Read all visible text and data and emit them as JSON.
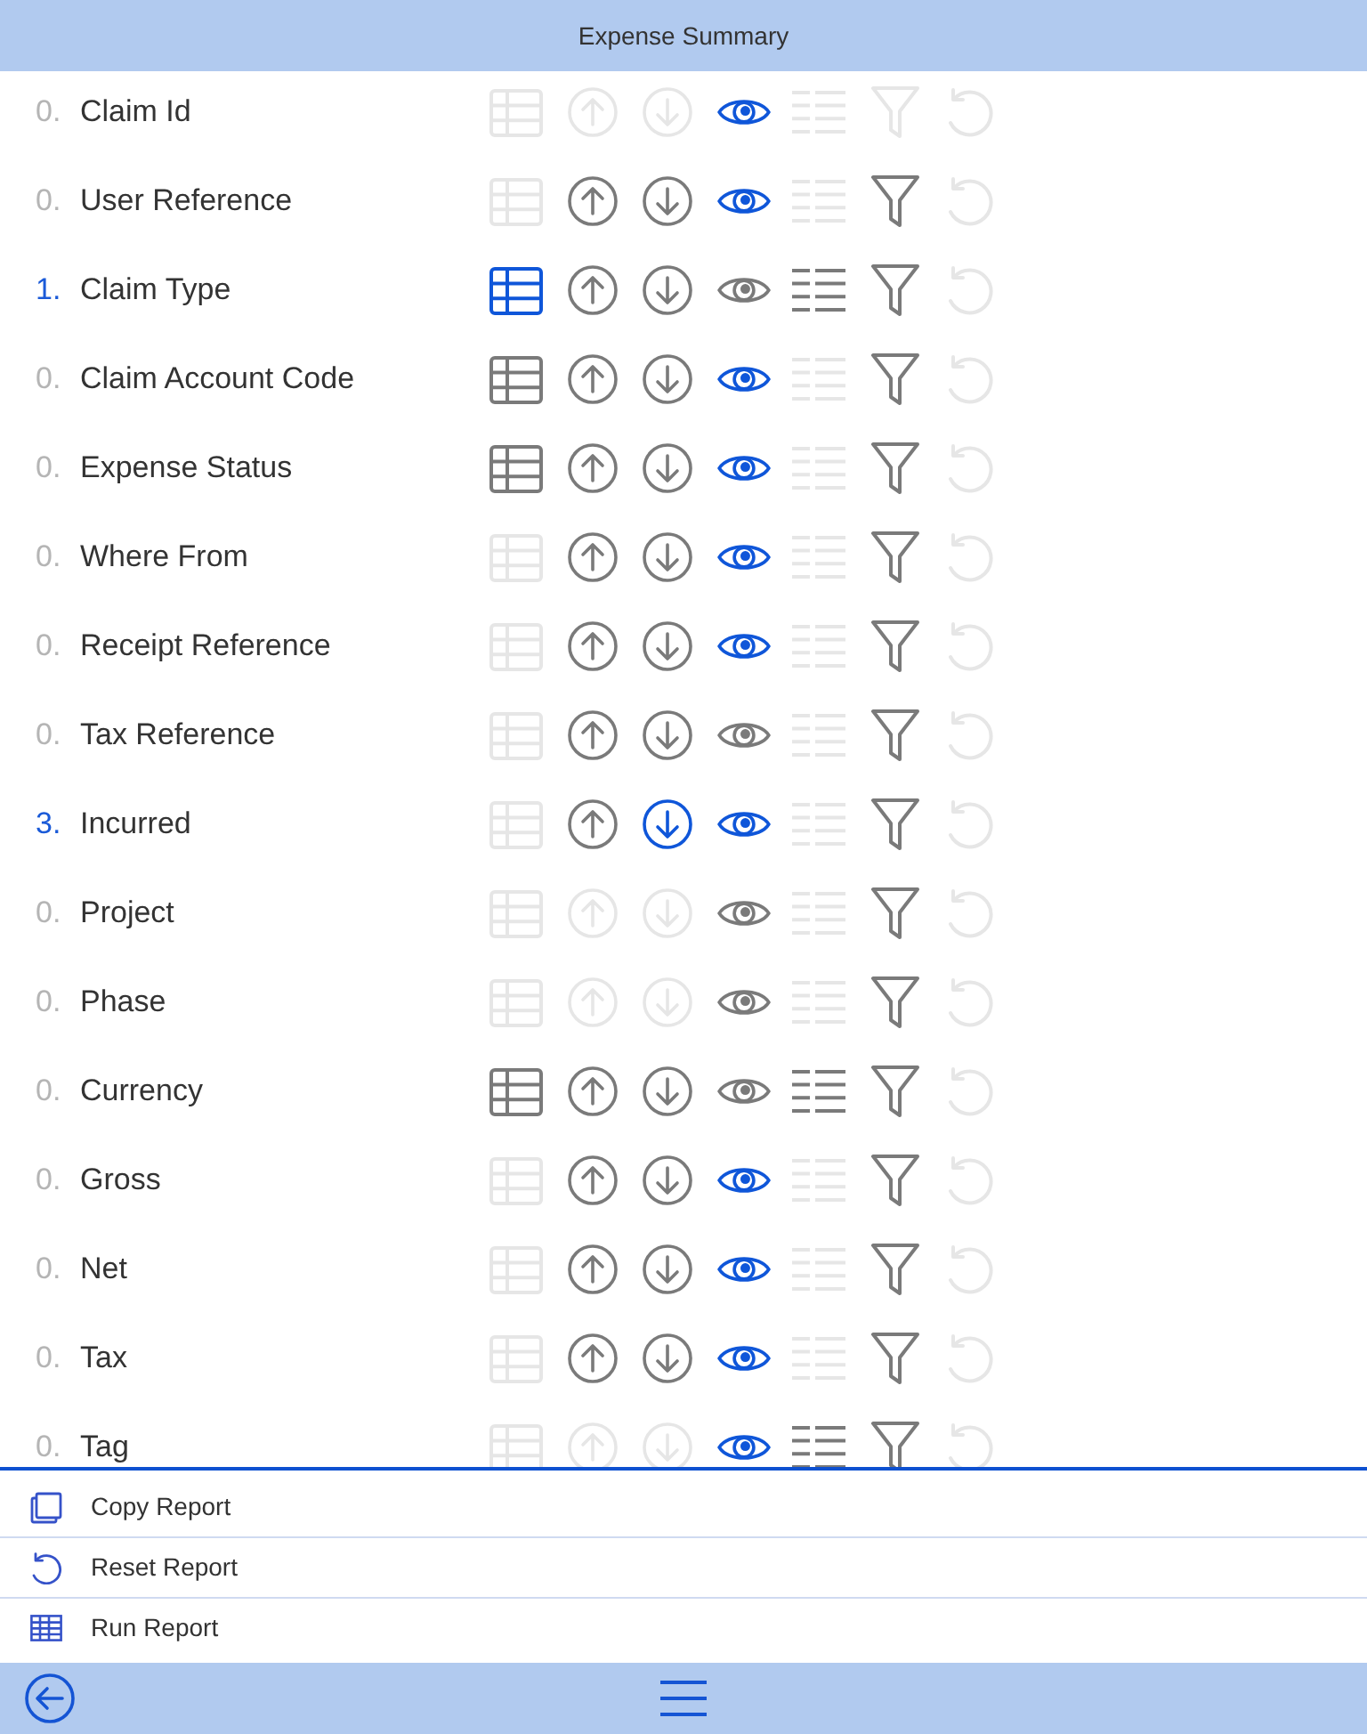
{
  "header": {
    "title": "Expense Summary"
  },
  "fields": [
    {
      "order": "0.",
      "order_active": false,
      "label": "Claim Id",
      "controls": {
        "table": {
          "disabled": true,
          "active": false
        },
        "sort_up": {
          "disabled": true,
          "active": false
        },
        "sort_down": {
          "disabled": true,
          "active": false
        },
        "eye": {
          "disabled": false,
          "active": true
        },
        "list": {
          "disabled": true,
          "active": false
        },
        "filter": {
          "disabled": true,
          "active": false
        },
        "reset": {
          "disabled": true,
          "active": false
        }
      }
    },
    {
      "order": "0.",
      "order_active": false,
      "label": "User Reference",
      "controls": {
        "table": {
          "disabled": true,
          "active": false
        },
        "sort_up": {
          "disabled": false,
          "active": false
        },
        "sort_down": {
          "disabled": false,
          "active": false
        },
        "eye": {
          "disabled": false,
          "active": true
        },
        "list": {
          "disabled": true,
          "active": false
        },
        "filter": {
          "disabled": false,
          "active": false
        },
        "reset": {
          "disabled": true,
          "active": false
        }
      }
    },
    {
      "order": "1.",
      "order_active": true,
      "label": "Claim Type",
      "controls": {
        "table": {
          "disabled": false,
          "active": true
        },
        "sort_up": {
          "disabled": false,
          "active": false
        },
        "sort_down": {
          "disabled": false,
          "active": false
        },
        "eye": {
          "disabled": false,
          "active": false
        },
        "list": {
          "disabled": false,
          "active": false
        },
        "filter": {
          "disabled": false,
          "active": false
        },
        "reset": {
          "disabled": true,
          "active": false
        }
      }
    },
    {
      "order": "0.",
      "order_active": false,
      "label": "Claim Account Code",
      "controls": {
        "table": {
          "disabled": false,
          "active": false
        },
        "sort_up": {
          "disabled": false,
          "active": false
        },
        "sort_down": {
          "disabled": false,
          "active": false
        },
        "eye": {
          "disabled": false,
          "active": true
        },
        "list": {
          "disabled": true,
          "active": false
        },
        "filter": {
          "disabled": false,
          "active": false
        },
        "reset": {
          "disabled": true,
          "active": false
        }
      }
    },
    {
      "order": "0.",
      "order_active": false,
      "label": "Expense Status",
      "controls": {
        "table": {
          "disabled": false,
          "active": false
        },
        "sort_up": {
          "disabled": false,
          "active": false
        },
        "sort_down": {
          "disabled": false,
          "active": false
        },
        "eye": {
          "disabled": false,
          "active": true
        },
        "list": {
          "disabled": true,
          "active": false
        },
        "filter": {
          "disabled": false,
          "active": false
        },
        "reset": {
          "disabled": true,
          "active": false
        }
      }
    },
    {
      "order": "0.",
      "order_active": false,
      "label": "Where From",
      "controls": {
        "table": {
          "disabled": true,
          "active": false
        },
        "sort_up": {
          "disabled": false,
          "active": false
        },
        "sort_down": {
          "disabled": false,
          "active": false
        },
        "eye": {
          "disabled": false,
          "active": true
        },
        "list": {
          "disabled": true,
          "active": false
        },
        "filter": {
          "disabled": false,
          "active": false
        },
        "reset": {
          "disabled": true,
          "active": false
        }
      }
    },
    {
      "order": "0.",
      "order_active": false,
      "label": "Receipt Reference",
      "controls": {
        "table": {
          "disabled": true,
          "active": false
        },
        "sort_up": {
          "disabled": false,
          "active": false
        },
        "sort_down": {
          "disabled": false,
          "active": false
        },
        "eye": {
          "disabled": false,
          "active": true
        },
        "list": {
          "disabled": true,
          "active": false
        },
        "filter": {
          "disabled": false,
          "active": false
        },
        "reset": {
          "disabled": true,
          "active": false
        }
      }
    },
    {
      "order": "0.",
      "order_active": false,
      "label": "Tax Reference",
      "controls": {
        "table": {
          "disabled": true,
          "active": false
        },
        "sort_up": {
          "disabled": false,
          "active": false
        },
        "sort_down": {
          "disabled": false,
          "active": false
        },
        "eye": {
          "disabled": false,
          "active": false
        },
        "list": {
          "disabled": true,
          "active": false
        },
        "filter": {
          "disabled": false,
          "active": false
        },
        "reset": {
          "disabled": true,
          "active": false
        }
      }
    },
    {
      "order": "3.",
      "order_active": true,
      "label": "Incurred",
      "controls": {
        "table": {
          "disabled": true,
          "active": false
        },
        "sort_up": {
          "disabled": false,
          "active": false
        },
        "sort_down": {
          "disabled": false,
          "active": true
        },
        "eye": {
          "disabled": false,
          "active": true
        },
        "list": {
          "disabled": true,
          "active": false
        },
        "filter": {
          "disabled": false,
          "active": false
        },
        "reset": {
          "disabled": true,
          "active": false
        }
      }
    },
    {
      "order": "0.",
      "order_active": false,
      "label": "Project",
      "controls": {
        "table": {
          "disabled": true,
          "active": false
        },
        "sort_up": {
          "disabled": true,
          "active": false
        },
        "sort_down": {
          "disabled": true,
          "active": false
        },
        "eye": {
          "disabled": false,
          "active": false
        },
        "list": {
          "disabled": true,
          "active": false
        },
        "filter": {
          "disabled": false,
          "active": false
        },
        "reset": {
          "disabled": true,
          "active": false
        }
      }
    },
    {
      "order": "0.",
      "order_active": false,
      "label": "Phase",
      "controls": {
        "table": {
          "disabled": true,
          "active": false
        },
        "sort_up": {
          "disabled": true,
          "active": false
        },
        "sort_down": {
          "disabled": true,
          "active": false
        },
        "eye": {
          "disabled": false,
          "active": false
        },
        "list": {
          "disabled": true,
          "active": false
        },
        "filter": {
          "disabled": false,
          "active": false
        },
        "reset": {
          "disabled": true,
          "active": false
        }
      }
    },
    {
      "order": "0.",
      "order_active": false,
      "label": "Currency",
      "controls": {
        "table": {
          "disabled": false,
          "active": false
        },
        "sort_up": {
          "disabled": false,
          "active": false
        },
        "sort_down": {
          "disabled": false,
          "active": false
        },
        "eye": {
          "disabled": false,
          "active": false
        },
        "list": {
          "disabled": false,
          "active": false
        },
        "filter": {
          "disabled": false,
          "active": false
        },
        "reset": {
          "disabled": true,
          "active": false
        }
      }
    },
    {
      "order": "0.",
      "order_active": false,
      "label": "Gross",
      "controls": {
        "table": {
          "disabled": true,
          "active": false
        },
        "sort_up": {
          "disabled": false,
          "active": false
        },
        "sort_down": {
          "disabled": false,
          "active": false
        },
        "eye": {
          "disabled": false,
          "active": true
        },
        "list": {
          "disabled": true,
          "active": false
        },
        "filter": {
          "disabled": false,
          "active": false
        },
        "reset": {
          "disabled": true,
          "active": false
        }
      }
    },
    {
      "order": "0.",
      "order_active": false,
      "label": "Net",
      "controls": {
        "table": {
          "disabled": true,
          "active": false
        },
        "sort_up": {
          "disabled": false,
          "active": false
        },
        "sort_down": {
          "disabled": false,
          "active": false
        },
        "eye": {
          "disabled": false,
          "active": true
        },
        "list": {
          "disabled": true,
          "active": false
        },
        "filter": {
          "disabled": false,
          "active": false
        },
        "reset": {
          "disabled": true,
          "active": false
        }
      }
    },
    {
      "order": "0.",
      "order_active": false,
      "label": "Tax",
      "controls": {
        "table": {
          "disabled": true,
          "active": false
        },
        "sort_up": {
          "disabled": false,
          "active": false
        },
        "sort_down": {
          "disabled": false,
          "active": false
        },
        "eye": {
          "disabled": false,
          "active": true
        },
        "list": {
          "disabled": true,
          "active": false
        },
        "filter": {
          "disabled": false,
          "active": false
        },
        "reset": {
          "disabled": true,
          "active": false
        }
      }
    },
    {
      "order": "0.",
      "order_active": false,
      "label": "Tag",
      "controls": {
        "table": {
          "disabled": true,
          "active": false
        },
        "sort_up": {
          "disabled": true,
          "active": false
        },
        "sort_down": {
          "disabled": true,
          "active": false
        },
        "eye": {
          "disabled": false,
          "active": true
        },
        "list": {
          "disabled": false,
          "active": false
        },
        "filter": {
          "disabled": false,
          "active": false
        },
        "reset": {
          "disabled": true,
          "active": false
        }
      }
    }
  ],
  "actions": [
    {
      "kind": "copy",
      "label": "Copy Report"
    },
    {
      "kind": "reset",
      "label": "Reset Report"
    },
    {
      "kind": "run",
      "label": "Run Report"
    }
  ]
}
